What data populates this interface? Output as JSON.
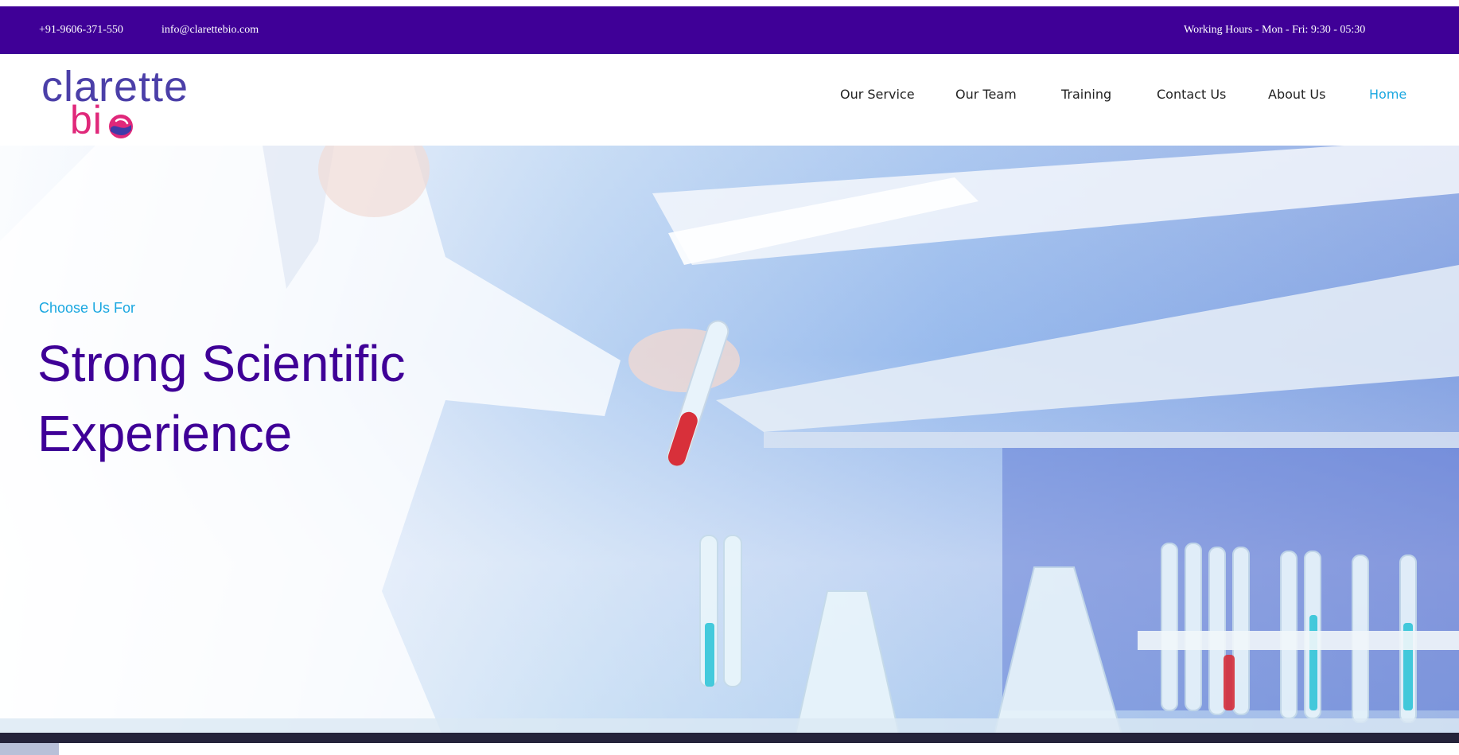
{
  "topbar": {
    "phone": "+91-9606-371-550",
    "email": "info@clarettebio.com",
    "hours": "Working Hours - Mon - Fri: 9:30 - 05:30"
  },
  "logo": {
    "line1": "clarette",
    "line2": "bi"
  },
  "nav": {
    "items": [
      {
        "label": "Our Service"
      },
      {
        "label": "Our Team"
      },
      {
        "label": "Training"
      },
      {
        "label": "Contact Us"
      },
      {
        "label": "About Us"
      },
      {
        "label": "Home"
      }
    ],
    "active": "Home"
  },
  "hero": {
    "kicker": "Choose Us For",
    "title": "Strong Scientific Experience"
  },
  "colors": {
    "brand_purple": "#3f0097",
    "accent_cyan": "#19a7e0",
    "logo_pink": "#e0287a",
    "logo_blue": "#4b3fa8"
  }
}
